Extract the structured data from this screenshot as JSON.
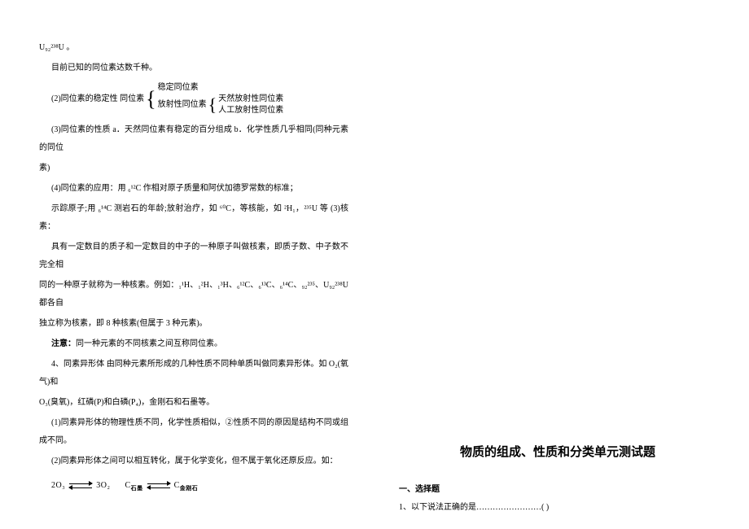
{
  "left": {
    "l0": "U₉₂²³⁸U 。",
    "l1": "目前已知的同位素达数千种。",
    "l2": "(2)同位素的稳定性 同位素",
    "brace": {
      "a": "稳定同位素",
      "b": "放射性同位素",
      "b1": "天然放射性同位素",
      "b2": "人工放射性同位素"
    },
    "l3": "(3)同位素的性质  a．天然同位素有稳定的百分组成 b．化学性质几乎相同(同种元素的同位",
    "l3b": "素)",
    "l4": "(4)同位素的应用：用 ₆¹²C 作相对原子质量和阿伏加德罗常数的标准；",
    "l5": "示踪原子;用 ₆¹⁴C 测岩石的年龄;放射治疗，如 ⁶⁰C，等核能，如 ²H₁，²³⁵U 等    (3)核素：",
    "l6": "具有一定数目的质子和一定数目的中子的一种原子叫做核素，即质子数、中子数不完全相",
    "l7": "同的一种原子就称为一种核素。例如：₁¹H、₁²H、₁³H、₆¹²C、₆¹³C、₆¹⁴C、₉₂²³⁵、U₉₂²³⁸U 都各自",
    "l8": "独立称为核素，即 8 种核素(但属于 3 种元素)。",
    "l9_label": "注意：",
    "l9": "同一种元素的不同核素之间互称同位素。",
    "l10": "4、同素异形体  由同种元素所形成的几种性质不同种单质叫做同素异形体。如 O₂(氧气)和",
    "l11": "O₃(臭氧)，红磷(P)和白磷(P₄)，金刚石和石墨等。",
    "l12": "(1)同素异形体的物理性质不同，化学性质相似，②性质不同的原因是结构不同或组成不同。",
    "l13": "(2)同素异形体之间可以相互转化，属于化学变化，但不属于氧化还原反应。如：",
    "eq_a": "2O₃",
    "eq_b": "3O₂",
    "eq_c": "C",
    "eq_c_sub1": "石墨",
    "eq_d": "C",
    "eq_d_sub1": "金刚石"
  },
  "right": {
    "title": "物质的组成、性质和分类单元测试题",
    "section1": "一、选择题",
    "q1": "1、以下说法正确的是……………………(        )"
  }
}
